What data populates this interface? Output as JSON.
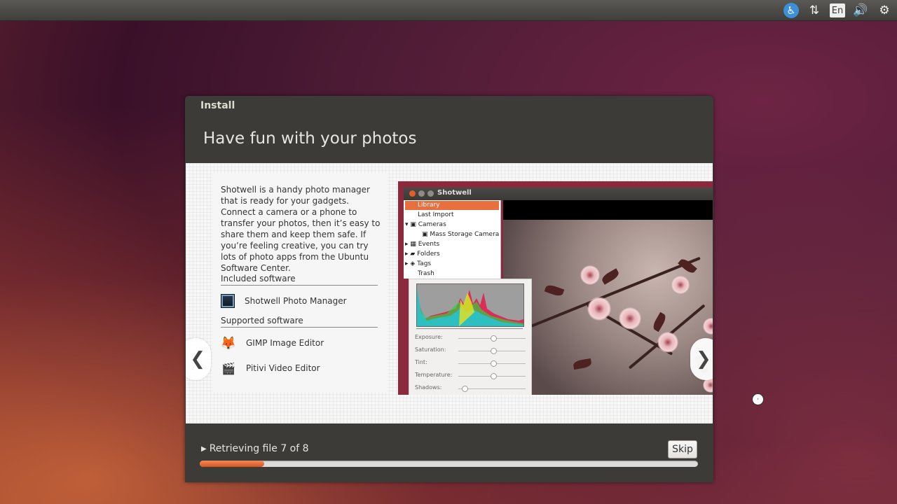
{
  "panel": {
    "indicators": [
      {
        "icon": "accessibility-icon",
        "glyph": "♿"
      },
      {
        "icon": "network-transfer-icon",
        "glyph": "⇅"
      },
      {
        "icon": "keyboard-layout-icon",
        "label": "En"
      },
      {
        "icon": "volume-icon",
        "glyph": "🔊"
      },
      {
        "icon": "session-gear-icon",
        "glyph": "⚙"
      }
    ]
  },
  "window": {
    "title": "Install",
    "heading": "Have fun with your photos"
  },
  "slide": {
    "description": "Shotwell is a handy photo manager that is ready for your gadgets. Connect a camera or a phone to transfer your photos, then it’s easy to share them and keep them safe. If you’re feeling creative, you can try lots of photo apps from the Ubuntu Software Center.",
    "included_label": "Included software",
    "included": [
      {
        "name": "Shotwell Photo Manager",
        "icon": "shotwell-icon"
      }
    ],
    "supported_label": "Supported software",
    "supported": [
      {
        "name": "GIMP Image Editor",
        "icon": "gimp-icon"
      },
      {
        "name": "Pitivi Video Editor",
        "icon": "pitivi-icon"
      }
    ],
    "prev_glyph": "❮",
    "next_glyph": "❯",
    "screenshot": {
      "title": "Shotwell",
      "tree": [
        {
          "label": "Library",
          "selected": true
        },
        {
          "label": "Last Import"
        },
        {
          "label": "Cameras"
        },
        {
          "label": "Mass Storage Camera"
        },
        {
          "label": "Events"
        },
        {
          "label": "Folders"
        },
        {
          "label": "Tags"
        },
        {
          "label": "Trash"
        }
      ],
      "adjustments": [
        {
          "label": "Exposure:",
          "level": 0.5
        },
        {
          "label": "Saturation:",
          "level": 0.5
        },
        {
          "label": "Tint:",
          "level": 0.5
        },
        {
          "label": "Temperature:",
          "level": 0.5
        },
        {
          "label": "Shadows:",
          "level": 0.05
        }
      ]
    }
  },
  "footer": {
    "status": "Retrieving file 7 of 8",
    "skip_label": "Skip",
    "progress": 0.13
  },
  "colors": {
    "accent": "#dd4814",
    "window_bg": "#3c3b37"
  }
}
